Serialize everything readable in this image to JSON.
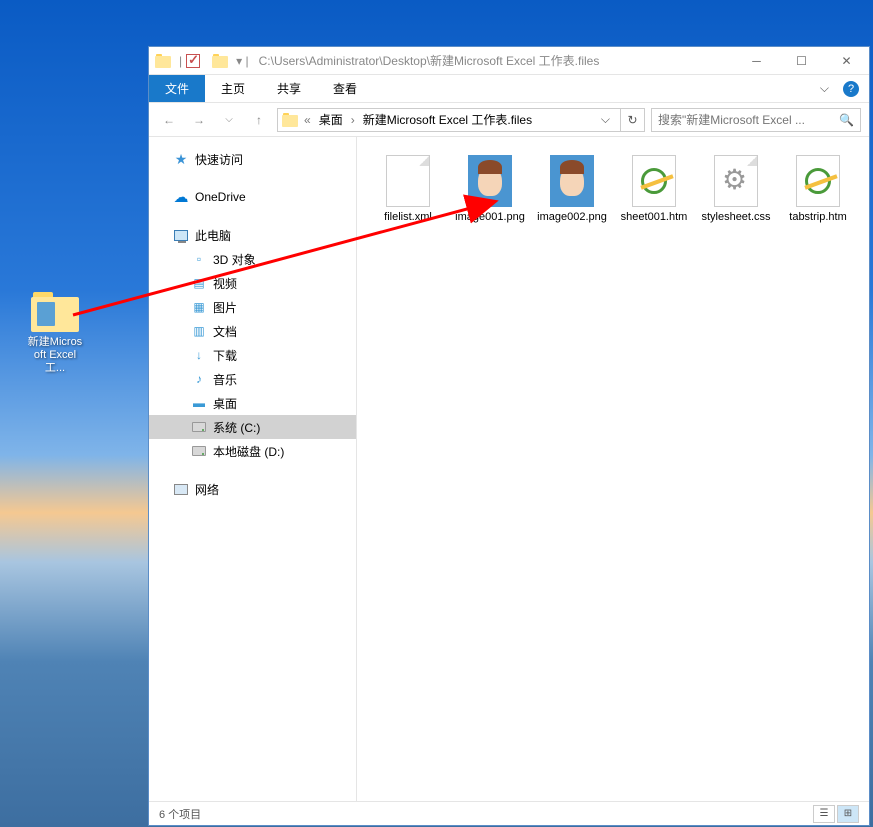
{
  "desktop": {
    "icon_label": "新建Microsoft Excel 工..."
  },
  "title": {
    "path": "C:\\Users\\Administrator\\Desktop\\新建Microsoft Excel 工作表.files"
  },
  "menubar": {
    "file": "文件",
    "home": "主页",
    "share": "共享",
    "view": "查看"
  },
  "breadcrumb": {
    "desktop": "桌面",
    "folder": "新建Microsoft Excel 工作表.files"
  },
  "search": {
    "placeholder": "搜索\"新建Microsoft Excel ..."
  },
  "sidebar": {
    "quick_access": "快速访问",
    "onedrive": "OneDrive",
    "this_pc": "此电脑",
    "threeDObjects": "3D 对象",
    "videos": "视频",
    "pictures": "图片",
    "documents": "文档",
    "downloads": "下载",
    "music": "音乐",
    "desktop": "桌面",
    "drive_c": "系统 (C:)",
    "drive_d": "本地磁盘 (D:)",
    "network": "网络"
  },
  "files": [
    {
      "name": "filelist.xml",
      "type": "doc"
    },
    {
      "name": "image001.png",
      "type": "img"
    },
    {
      "name": "image002.png",
      "type": "img"
    },
    {
      "name": "sheet001.htm",
      "type": "htm"
    },
    {
      "name": "stylesheet.css",
      "type": "gear"
    },
    {
      "name": "tabstrip.htm",
      "type": "htm"
    }
  ],
  "statusbar": {
    "items": "6 个项目"
  }
}
